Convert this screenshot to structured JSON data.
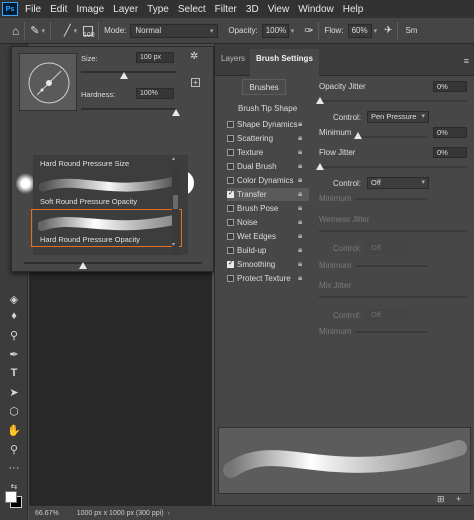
{
  "menu": {
    "logo": "Ps",
    "items": [
      "File",
      "Edit",
      "Image",
      "Layer",
      "Type",
      "Select",
      "Filter",
      "3D",
      "View",
      "Window",
      "Help"
    ]
  },
  "options": {
    "brush_size": "100",
    "mode_label": "Mode:",
    "mode_value": "Normal",
    "opacity_label": "Opacity:",
    "opacity_value": "100%",
    "flow_label": "Flow:",
    "flow_value": "60%",
    "trailing_text": "Sm"
  },
  "picker": {
    "size_label": "Size:",
    "size_value": "100 px",
    "hardness_label": "Hardness:",
    "hardness_value": "100%",
    "size_level_pct": 45,
    "hardness_level_pct": 100,
    "presets": [
      {
        "name": "Hard Round Pressure Size"
      },
      {
        "name": "Soft Round Pressure Opacity"
      },
      {
        "name": "Hard Round Pressure Opacity",
        "selected": true
      }
    ]
  },
  "panel": {
    "tabs": [
      "Layers",
      "Brush Settings"
    ],
    "active_tab": "Brush Settings",
    "brushes_button": "Brushes",
    "tip_shape_label": "Brush Tip Shape",
    "options": [
      {
        "label": "Shape Dynamics",
        "checked": false
      },
      {
        "label": "Scattering",
        "checked": false
      },
      {
        "label": "Texture",
        "checked": false
      },
      {
        "label": "Dual Brush",
        "checked": false
      },
      {
        "label": "Color Dynamics",
        "checked": false
      },
      {
        "label": "Transfer",
        "checked": true,
        "selected": true
      },
      {
        "label": "Brush Pose",
        "checked": false
      },
      {
        "label": "Noise",
        "checked": false
      },
      {
        "label": "Wet Edges",
        "checked": false
      },
      {
        "label": "Build-up",
        "checked": false
      },
      {
        "label": "Smoothing",
        "checked": true
      },
      {
        "label": "Protect Texture",
        "checked": false
      }
    ],
    "settings": {
      "opacity_jitter_label": "Opacity Jitter",
      "opacity_jitter_value": "0%",
      "control_label": "Control:",
      "control_value_1": "Pen Pressure",
      "minimum_label": "Minimum",
      "minimum_value": "0%",
      "flow_jitter_label": "Flow Jitter",
      "flow_jitter_value": "0%",
      "control_value_2": "Off",
      "minimum_label_2": "Minimum",
      "wetness_jitter_label": "Wetness Jitter",
      "control_value_3": "Off",
      "minimum_label_3": "Minimum",
      "mix_jitter_label": "Mix Jitter",
      "control_value_4": "Off",
      "minimum_label_4": "Minimum"
    }
  },
  "status": {
    "zoom": "66.67%",
    "doc_info": "1000 px x 1000 px (300 ppi)"
  }
}
